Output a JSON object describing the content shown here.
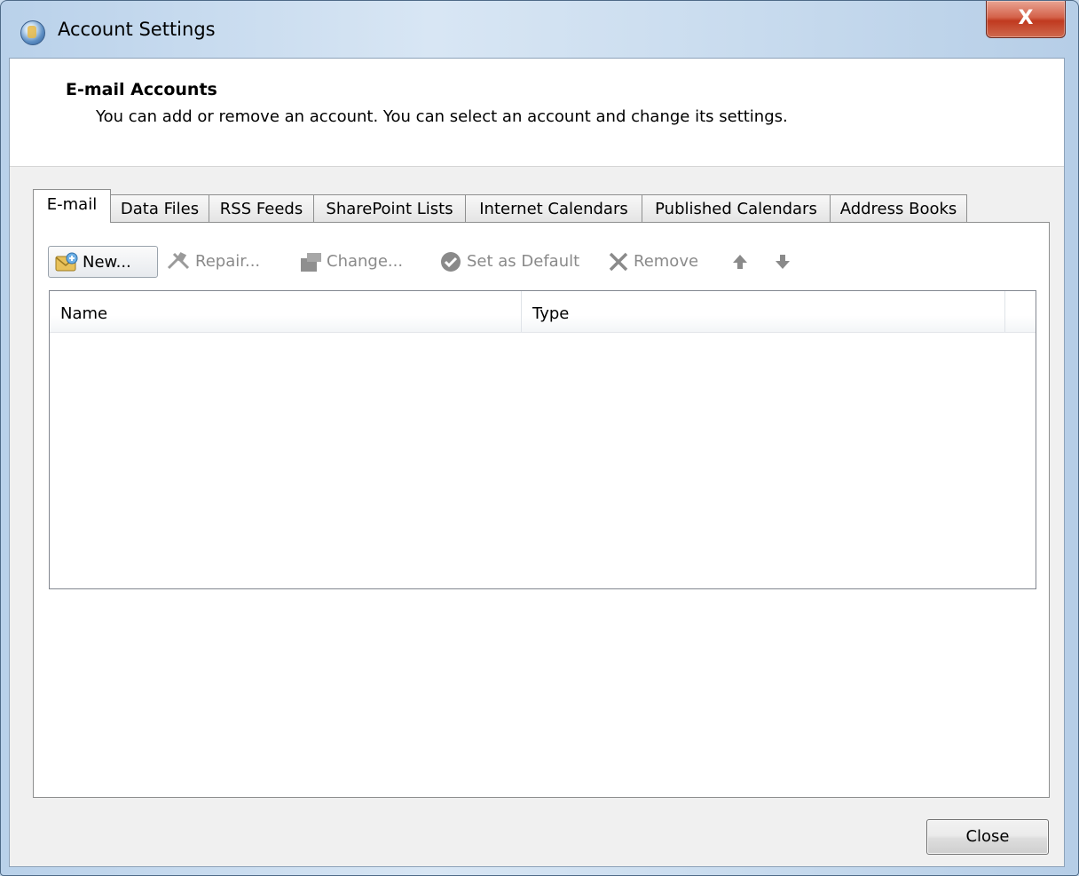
{
  "window": {
    "title": "Account Settings",
    "close_glyph": "X"
  },
  "header": {
    "title": "E-mail Accounts",
    "description": "You can add or remove an account. You can select an account and change its settings."
  },
  "tabs": [
    {
      "label": "E-mail",
      "active": true
    },
    {
      "label": "Data Files"
    },
    {
      "label": "RSS Feeds"
    },
    {
      "label": "SharePoint Lists"
    },
    {
      "label": "Internet Calendars"
    },
    {
      "label": "Published Calendars"
    },
    {
      "label": "Address Books"
    }
  ],
  "toolbar": {
    "new_label": "New...",
    "repair_label": "Repair...",
    "change_label": "Change...",
    "default_label": "Set as Default",
    "remove_label": "Remove",
    "icons": [
      "new-mail-icon",
      "repair-icon",
      "change-icon",
      "check-circle-icon",
      "remove-x-icon",
      "arrow-up-icon",
      "arrow-down-icon"
    ]
  },
  "list": {
    "columns": [
      "Name",
      "Type"
    ],
    "rows": []
  },
  "footer": {
    "close_label": "Close"
  }
}
